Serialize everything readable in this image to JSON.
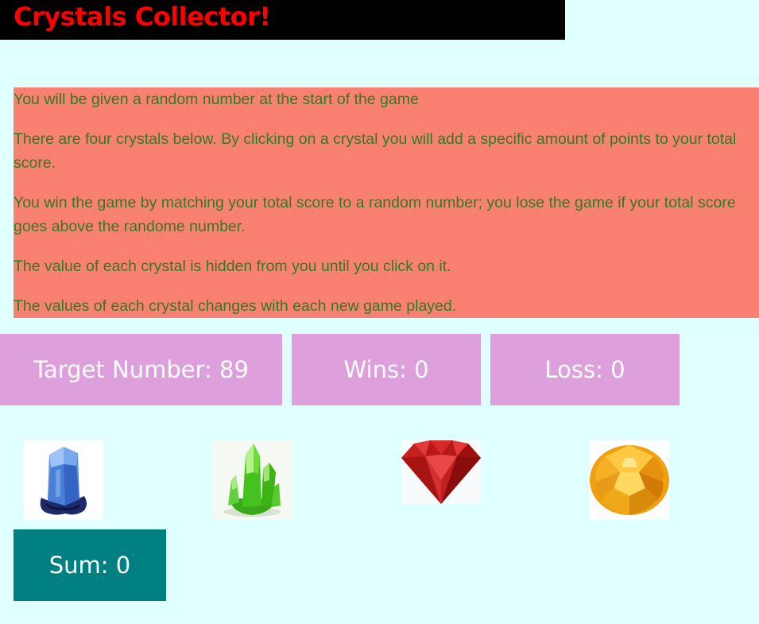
{
  "header": {
    "title": "Crystals Collector!"
  },
  "instructions": [
    "You will be given a random number at the start of the game",
    "There are four crystals below. By clicking on a crystal you will add a specific amount of points to your total score.",
    "You win the game by matching your total score to a random number; you lose the game if your total score goes above the randome number.",
    "The value of each crystal is hidden from you until you click on it.",
    "The values of each crystal changes with each new game played."
  ],
  "stats": {
    "target_label": "Target Number:",
    "target_value": "89",
    "wins_label": "Wins:",
    "wins_value": "0",
    "loss_label": "Loss:",
    "loss_value": "0"
  },
  "crystals": [
    {
      "icon": "blue-crystal-icon"
    },
    {
      "icon": "green-crystal-icon"
    },
    {
      "icon": "red-gem-icon"
    },
    {
      "icon": "yellow-gem-icon"
    }
  ],
  "sum": {
    "label": "Sum:",
    "value": "0"
  },
  "colors": {
    "background": "#e0ffff",
    "title_bar": "#000000",
    "title_text": "#ff0000",
    "instructions_bg": "#fa8072",
    "instructions_text": "#2e7d1f",
    "stat_bg": "#dda0dd",
    "sum_bg": "#008080"
  }
}
